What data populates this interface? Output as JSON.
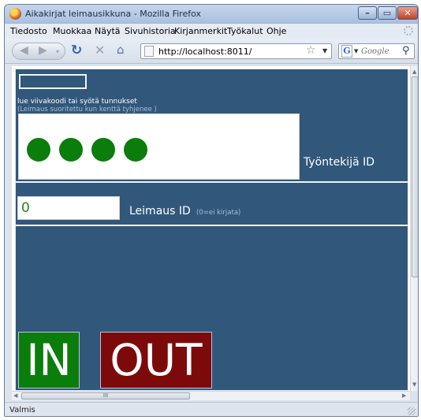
{
  "window": {
    "title": "Aikakirjat leimausikkuna - Mozilla Firefox"
  },
  "menubar": {
    "items": [
      "Tiedosto",
      "Muokkaa",
      "Näytä",
      "Sivuhistoria",
      "Kirjanmerkit",
      "Työkalut",
      "Ohje"
    ]
  },
  "navbar": {
    "url": "http://localhost:8011/",
    "search_placeholder": "Google",
    "search_engine_glyph": "G"
  },
  "page": {
    "background_color": "#31577a",
    "scan_value": "",
    "instruction": "lue viivakoodi tai syötä tunnukset",
    "instruction_sub": "(Leimaus suoritettu kun kenttä tyhjenee )",
    "pin_dots": 4,
    "pin_dot_color": "#0a7d0a",
    "employee_label": "Työntekijä ID",
    "stamp_value": "0",
    "stamp_label": "Leimaus ID",
    "stamp_hint": "(0=ei kirjata)",
    "in_label": "IN",
    "in_color": "#0b7d0b",
    "out_label": "OUT",
    "out_color": "#7d0a0a"
  },
  "statusbar": {
    "text": "Valmis"
  },
  "hscroll": {
    "thumb_grip": "III"
  }
}
